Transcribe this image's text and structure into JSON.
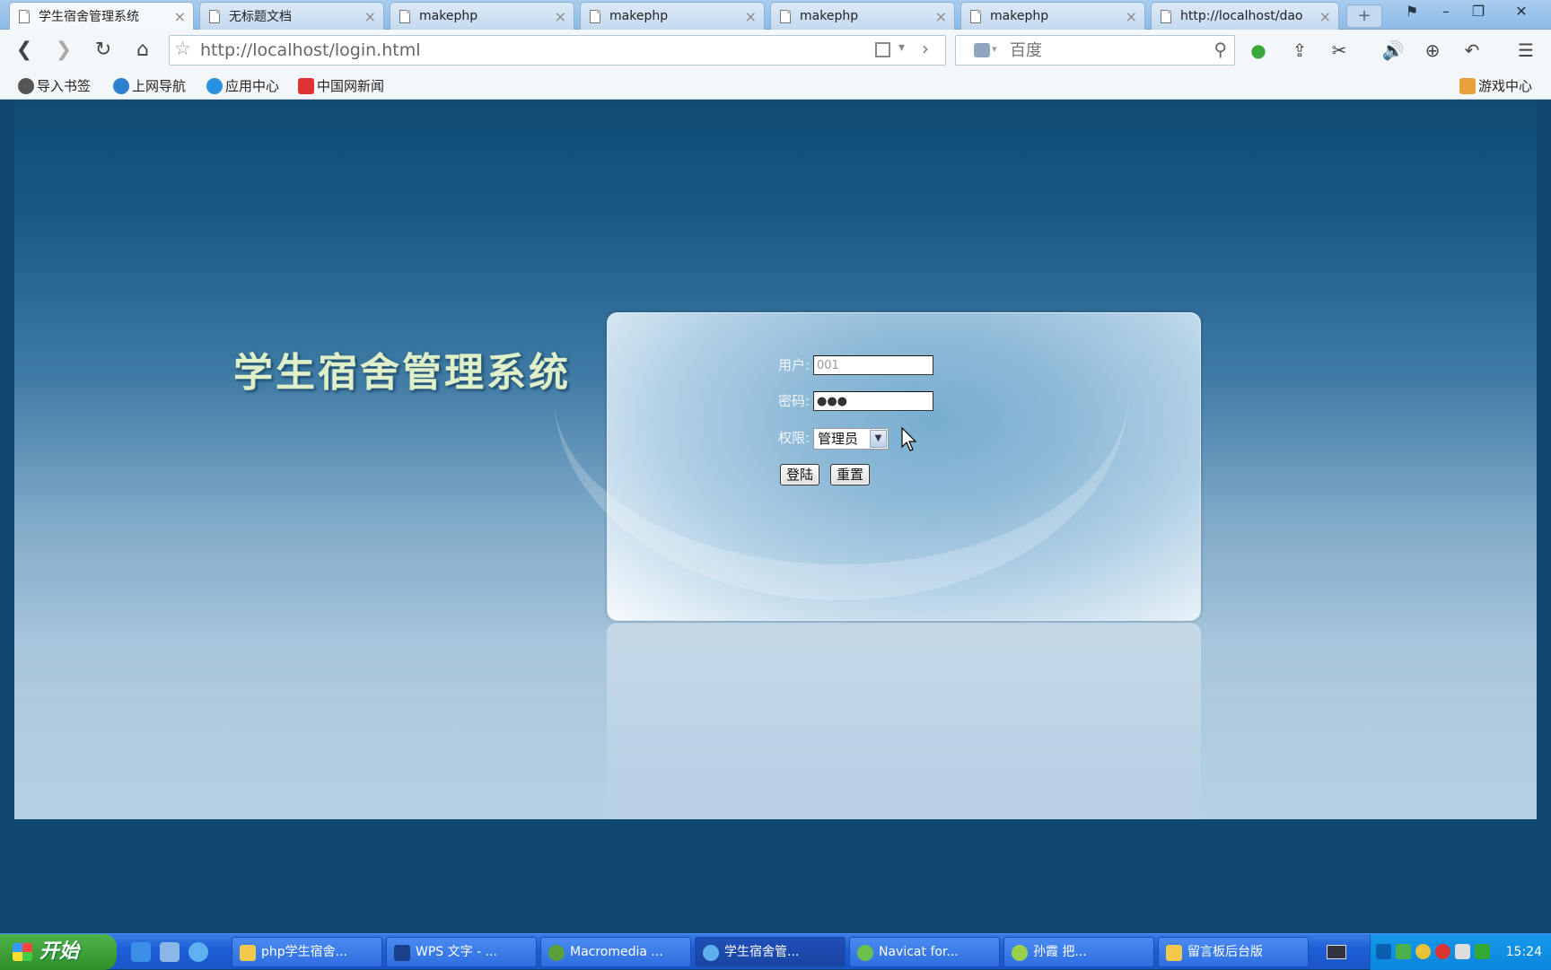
{
  "browser": {
    "tabs": [
      {
        "label": "学生宿舍管理系统",
        "active": true
      },
      {
        "label": "无标题文档",
        "active": false
      },
      {
        "label": "makephp",
        "active": false
      },
      {
        "label": "makephp",
        "active": false
      },
      {
        "label": "makephp",
        "active": false
      },
      {
        "label": "makephp",
        "active": false
      },
      {
        "label": "http://localhost/dao",
        "active": false
      }
    ],
    "new_tab_label": "+",
    "address": "http://localhost/login.html",
    "search_placeholder": "百度",
    "bookmarks": [
      {
        "label": "导入书签",
        "icon": "import-icon"
      },
      {
        "label": "上网导航",
        "icon": "ie-icon"
      },
      {
        "label": "应用中心",
        "icon": "app-center-icon"
      },
      {
        "label": "中国网新闻",
        "icon": "news-icon"
      }
    ],
    "right_bookmark": "游戏中心"
  },
  "page": {
    "title": "学生宿舍管理系统",
    "form": {
      "user_label": "用户:",
      "user_value": "001",
      "password_label": "密码:",
      "password_value": "●●●",
      "role_label": "权限:",
      "role_value": "管理员",
      "login_button": "登陆",
      "reset_button": "重置"
    }
  },
  "taskbar": {
    "start_label": "开始",
    "tasks": [
      {
        "label": "php学生宿舍...",
        "active": false
      },
      {
        "label": "WPS 文字 - ...",
        "active": false
      },
      {
        "label": "Macromedia ...",
        "active": false
      },
      {
        "label": "学生宿舍管...",
        "active": true
      },
      {
        "label": "Navicat for...",
        "active": false
      },
      {
        "label": "孙霞   把...",
        "active": false
      },
      {
        "label": "留言板后台版",
        "active": false
      }
    ],
    "clock": "15:24"
  }
}
